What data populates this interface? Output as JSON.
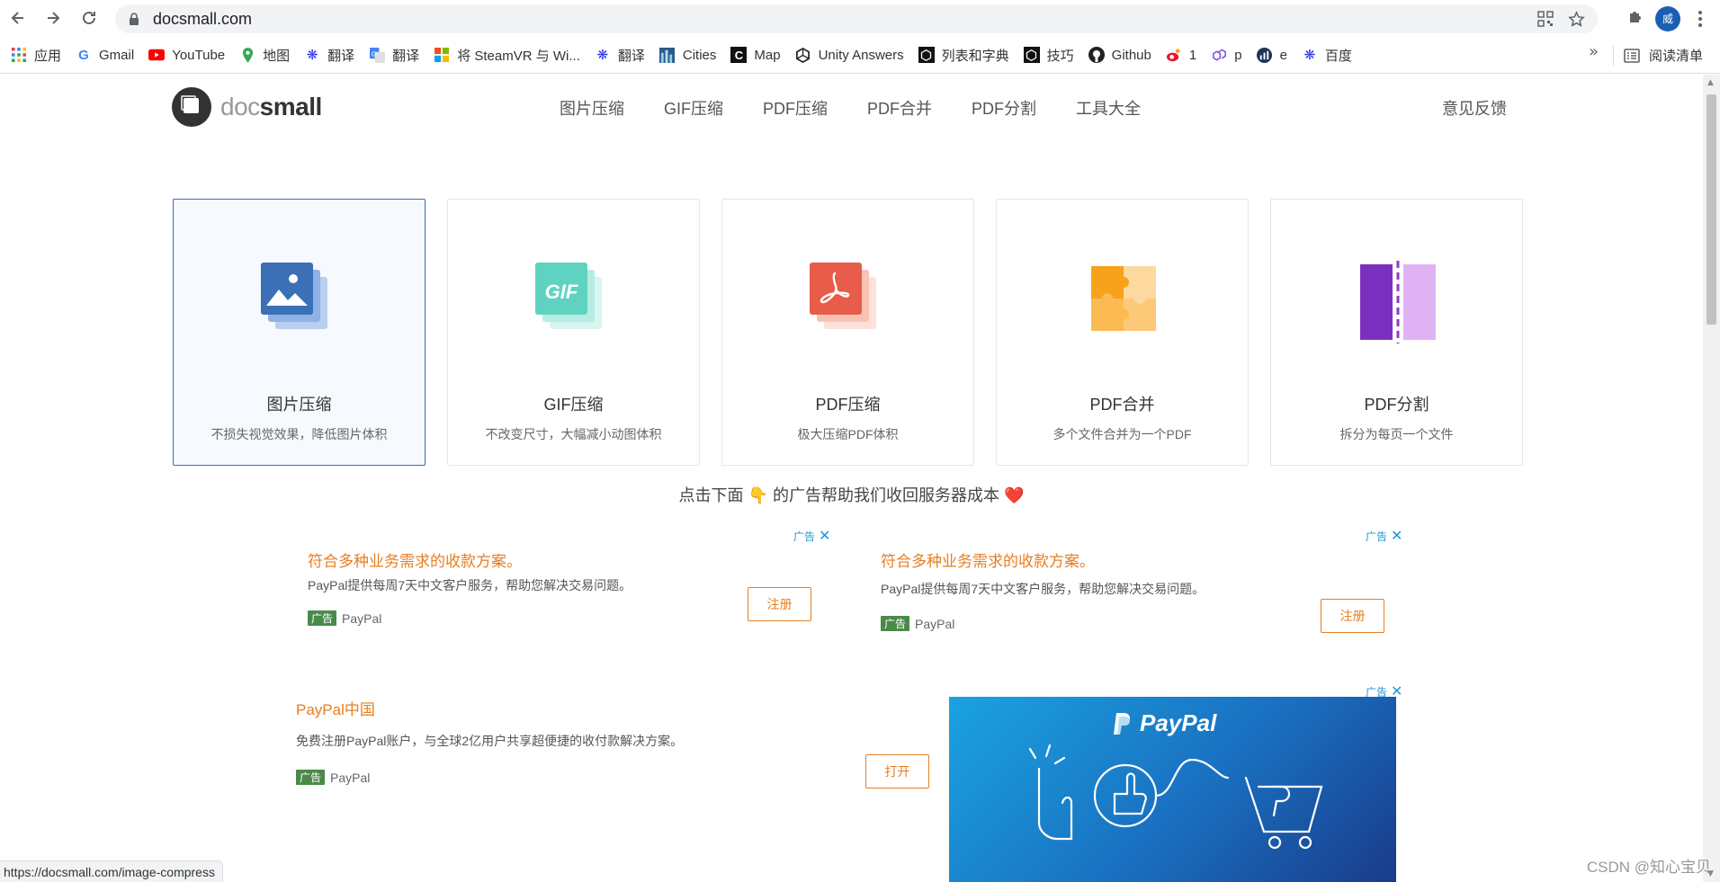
{
  "browser": {
    "url": "docsmall.com",
    "bookmarks": [
      {
        "label": "应用",
        "icon": "apps-grid-icon"
      },
      {
        "label": "Gmail",
        "icon": "google-icon"
      },
      {
        "label": "YouTube",
        "icon": "youtube-icon"
      },
      {
        "label": "地图",
        "icon": "maps-pin-icon"
      },
      {
        "label": "翻译",
        "icon": "baidu-paw-icon"
      },
      {
        "label": "翻译",
        "icon": "google-translate-icon"
      },
      {
        "label": "将 SteamVR 与 Wi...",
        "icon": "windows-icon"
      },
      {
        "label": "翻译",
        "icon": "baidu-paw-icon"
      },
      {
        "label": "Cities",
        "icon": "cities-icon"
      },
      {
        "label": "Map",
        "icon": "c-logo-icon"
      },
      {
        "label": "Unity Answers",
        "icon": "unity-icon"
      },
      {
        "label": "列表和字典",
        "icon": "unity-icon"
      },
      {
        "label": "技巧",
        "icon": "unity-icon"
      },
      {
        "label": "Github",
        "icon": "github-icon"
      },
      {
        "label": "1",
        "icon": "weibo-icon"
      },
      {
        "label": "p",
        "icon": "polygon-icon"
      },
      {
        "label": "e",
        "icon": "chart-icon"
      },
      {
        "label": "百度",
        "icon": "baidu-paw-icon"
      }
    ],
    "more": "»",
    "reading_list": "阅读清单",
    "avatar": "威",
    "status_url": "https://docsmall.com/image-compress"
  },
  "site": {
    "logo_doc": "doc",
    "logo_small": "small",
    "nav": [
      "图片压缩",
      "GIF压缩",
      "PDF压缩",
      "PDF合并",
      "PDF分割",
      "工具大全"
    ],
    "feedback": "意见反馈"
  },
  "cards": [
    {
      "title": "图片压缩",
      "desc": "不损失视觉效果，降低图片体积",
      "color": "#3b6fb6"
    },
    {
      "title": "GIF压缩",
      "desc": "不改变尺寸，大幅减小动图体积",
      "color": "#5fd3c0",
      "icon_text": "GIF"
    },
    {
      "title": "PDF压缩",
      "desc": "极大压缩PDF体积",
      "color": "#e85d4a"
    },
    {
      "title": "PDF合并",
      "desc": "多个文件合并为一个PDF",
      "color": "#f7a21b"
    },
    {
      "title": "PDF分割",
      "desc": "拆分为每页一个文件",
      "color": "#8e3bc4"
    }
  ],
  "ad_notice": {
    "before": "点击下面",
    "after": "的广告帮助我们收回服务器成本"
  },
  "ads": [
    {
      "title": "符合多种业务需求的收款方案。",
      "text": "PayPal提供每周7天中文客户服务，帮助您解决交易问题。",
      "tag": "广告",
      "brand": "PayPal",
      "button": "注册",
      "mark": "广告"
    },
    {
      "title": "符合多种业务需求的收款方案。",
      "text": "PayPal提供每周7天中文客户服务，帮助您解决交易问题。",
      "tag": "广告",
      "brand": "PayPal",
      "button": "注册",
      "mark": "广告"
    },
    {
      "title": "PayPal中国",
      "text": "免费注册PayPal账户，与全球2亿用户共享超便捷的收付款解决方案。",
      "tag": "广告",
      "brand": "PayPal",
      "button": "打开"
    }
  ],
  "banner": {
    "logo": "PayPal",
    "mark": "广告"
  },
  "watermark": "CSDN @知心宝贝"
}
